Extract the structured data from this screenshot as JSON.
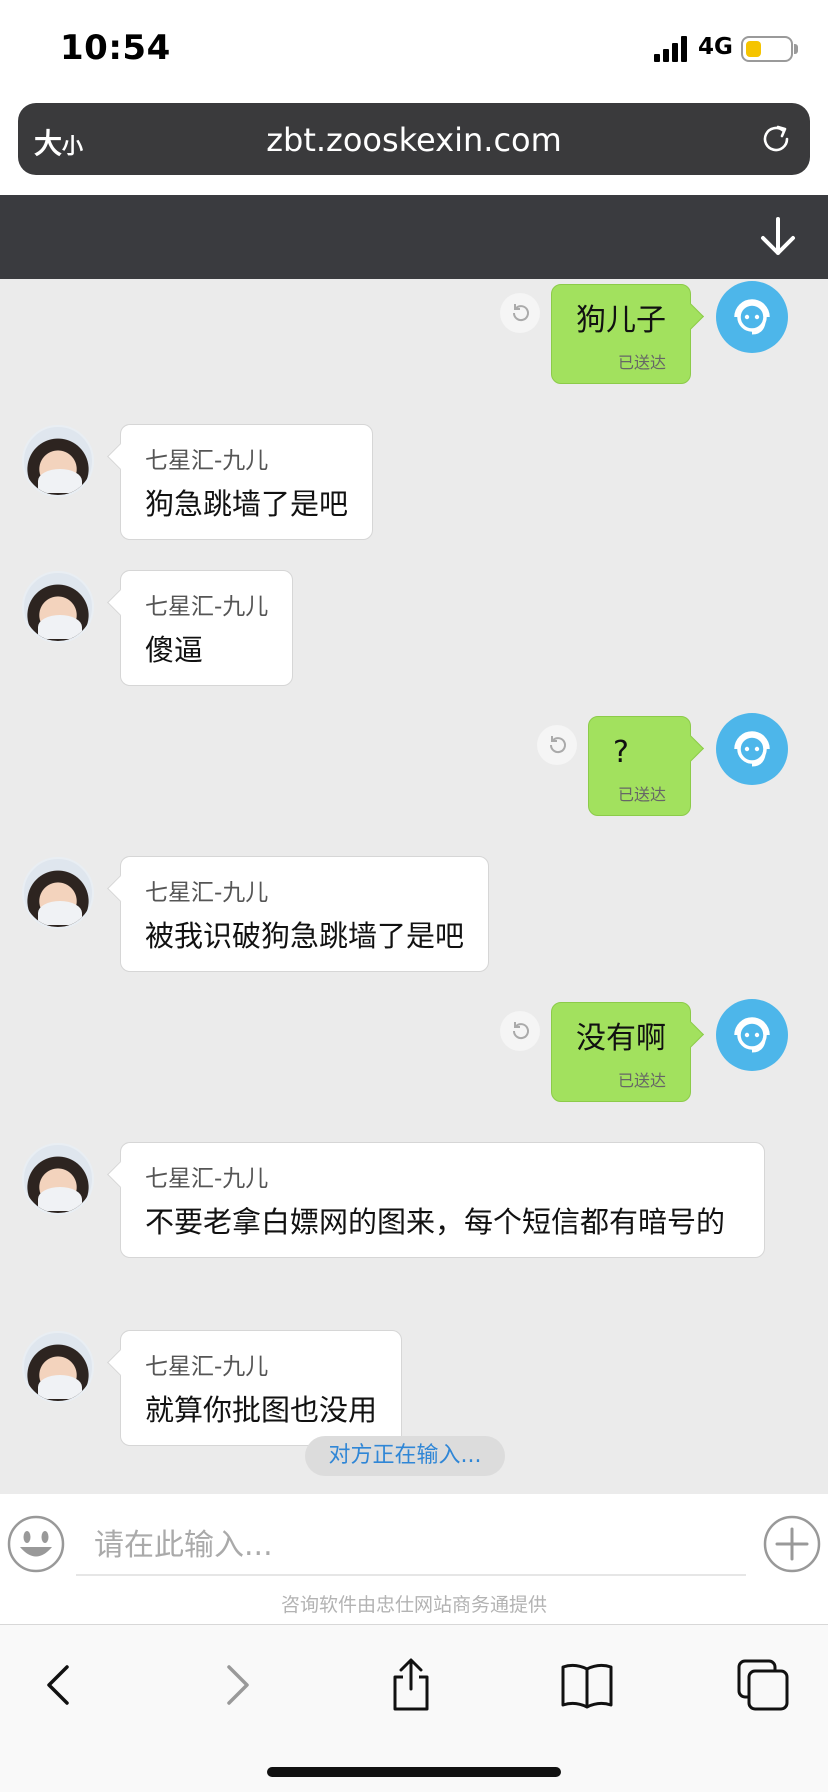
{
  "status_bar": {
    "time": "10:54",
    "network": "4G",
    "battery_level": 0.35,
    "battery_color": "#f5c400"
  },
  "browser": {
    "text_size_label": "大",
    "text_size_label_small": "小",
    "url": "zbt.zooskexin.com"
  },
  "messages": [
    {
      "side": "right",
      "text": "狗儿子",
      "status": "已送达"
    },
    {
      "side": "left",
      "sender": "七星汇-九儿",
      "text": "狗急跳墙了是吧"
    },
    {
      "side": "left",
      "sender": "七星汇-九儿",
      "text": "傻逼"
    },
    {
      "side": "right",
      "text": "?",
      "status": "已送达"
    },
    {
      "side": "left",
      "sender": "七星汇-九儿",
      "text": "被我识破狗急跳墙了是吧"
    },
    {
      "side": "right",
      "text": "没有啊",
      "status": "已送达"
    },
    {
      "side": "left",
      "sender": "七星汇-九儿",
      "text": "不要老拿白嫖网的图来，每个短信都有暗号的"
    },
    {
      "side": "left",
      "sender": "七星汇-九儿",
      "text": "就算你批图也没用"
    }
  ],
  "typing_indicator": "对方正在输入...",
  "composer": {
    "placeholder": "请在此输入...",
    "powered_by": "咨询软件由忠仕网站商务通提供"
  },
  "toolbar": {
    "icons": [
      "back-icon",
      "forward-icon",
      "share-icon",
      "bookmarks-icon",
      "tabs-icon"
    ]
  },
  "colors": {
    "agent_bubble": "#ffffff",
    "user_bubble": "#a2e15e",
    "user_avatar": "#4db6ea",
    "header": "#3a3b3f"
  }
}
